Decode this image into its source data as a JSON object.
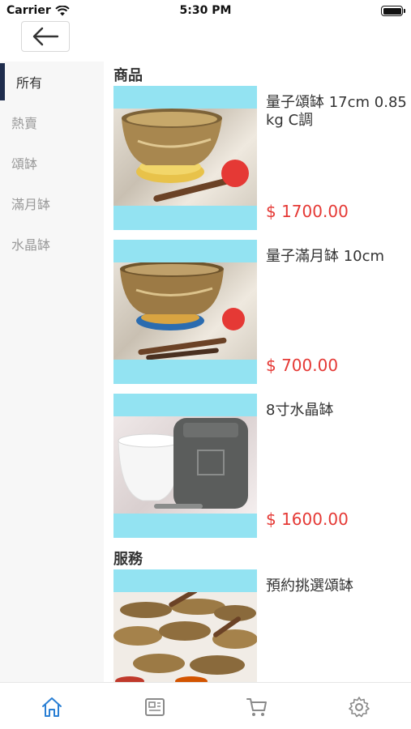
{
  "status_bar": {
    "carrier": "Carrier",
    "time": "5:30 PM"
  },
  "sidebar": {
    "items": [
      {
        "label": "所有",
        "active": true
      },
      {
        "label": "熱賣",
        "active": false
      },
      {
        "label": "頌缽",
        "active": false
      },
      {
        "label": "滿月缽",
        "active": false
      },
      {
        "label": "水晶缽",
        "active": false
      }
    ]
  },
  "sections": {
    "products_title": "商品",
    "services_title": "服務"
  },
  "products": [
    {
      "name": "量子頌缽 17cm 0.85 kg C調",
      "price": "$ 1700.00"
    },
    {
      "name": "量子滿月缽 10cm",
      "price": "$ 700.00"
    },
    {
      "name": "8寸水晶缽",
      "price": "$ 1600.00"
    }
  ],
  "services": [
    {
      "name": "預約挑選頌缽"
    }
  ],
  "tab_bar": {
    "active_color": "#2a7fd4",
    "inactive_color": "#8a8a8a",
    "tabs": [
      "home-icon",
      "news-icon",
      "cart-icon",
      "gear-icon"
    ]
  },
  "colors": {
    "price": "#e53935",
    "image_bg": "#93e3f2",
    "sidebar_indicator": "#1f2d4d"
  }
}
